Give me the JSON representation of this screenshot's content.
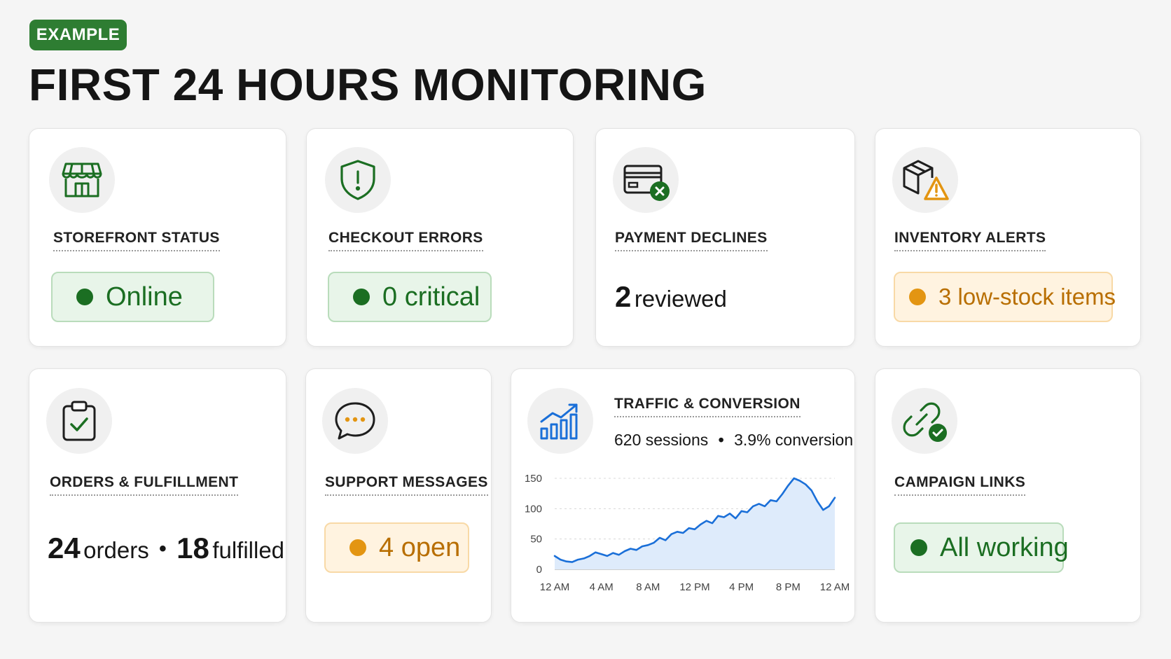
{
  "header": {
    "tag": "EXAMPLE",
    "title": "FIRST 24 HOURS MONITORING"
  },
  "cards": {
    "storefront": {
      "label": "STOREFRONT STATUS",
      "value": "Online",
      "icon": "storefront-icon"
    },
    "checkout": {
      "label": "CHECKOUT ERRORS",
      "value": "0 critical",
      "icon": "shield-alert-icon"
    },
    "payment": {
      "label": "PAYMENT DECLINES",
      "value_number": "2",
      "value_unit": "reviewed",
      "icon": "credit-card-declined-icon"
    },
    "inventory": {
      "label": "INVENTORY ALERTS",
      "value": "3 low-stock items",
      "icon": "box-warning-icon"
    },
    "orders": {
      "label": "ORDERS & FULFILLMENT",
      "orders_number": "24",
      "orders_unit": "orders",
      "separator": "•",
      "fulfilled_number": "18",
      "fulfilled_unit": "fulfilled",
      "icon": "clipboard-check-icon"
    },
    "support": {
      "label": "SUPPORT MESSAGES",
      "value": "4 open",
      "icon": "chat-bubble-icon"
    },
    "traffic": {
      "label": "TRAFFIC & CONVERSION",
      "sessions": "620 sessions",
      "separator": "•",
      "conversion": "3.9% conversion",
      "icon": "growth-chart-icon"
    },
    "campaign": {
      "label": "CAMPAIGN LINKS",
      "value": "All working",
      "icon": "link-check-icon"
    }
  },
  "colors": {
    "brand_green": "#2e7d32",
    "status_green": "#1b6e22",
    "status_orange": "#e39512",
    "chart_line": "#1a6fd8",
    "chart_fill": "#deebfb"
  },
  "chart_data": {
    "type": "area",
    "xlabel": "",
    "ylabel": "",
    "ylim": [
      0,
      150
    ],
    "yticks": [
      0,
      50,
      100,
      150
    ],
    "xlim": [
      0,
      24
    ],
    "xtick_positions": [
      0,
      4,
      8,
      12,
      16,
      20,
      24
    ],
    "xtick_labels": [
      "12 AM",
      "4 AM",
      "8 AM",
      "12 PM",
      "4 PM",
      "8 PM",
      "12 AM"
    ],
    "grid": true,
    "series": [
      {
        "x": [
          0,
          0.5,
          1,
          1.5,
          2,
          2.5,
          3,
          3.5,
          4,
          4.5,
          5,
          5.5,
          6,
          6.5,
          7,
          7.5,
          8,
          8.5,
          9,
          9.5,
          10,
          10.5,
          11,
          11.5,
          12,
          12.5,
          13,
          13.5,
          14,
          14.5,
          15,
          15.5,
          16,
          16.5,
          17,
          17.5,
          18,
          18.5,
          19,
          19.5,
          20,
          20.5,
          21,
          21.5,
          22,
          22.5,
          23,
          23.5,
          24
        ],
        "y": [
          22,
          16,
          13,
          12,
          16,
          18,
          22,
          28,
          25,
          22,
          27,
          24,
          30,
          34,
          32,
          38,
          40,
          44,
          52,
          48,
          58,
          62,
          60,
          68,
          66,
          74,
          80,
          76,
          88,
          86,
          92,
          84,
          96,
          94,
          104,
          108,
          104,
          114,
          112,
          124,
          138,
          150,
          146,
          140,
          130,
          112,
          98,
          104,
          118
        ]
      }
    ]
  }
}
